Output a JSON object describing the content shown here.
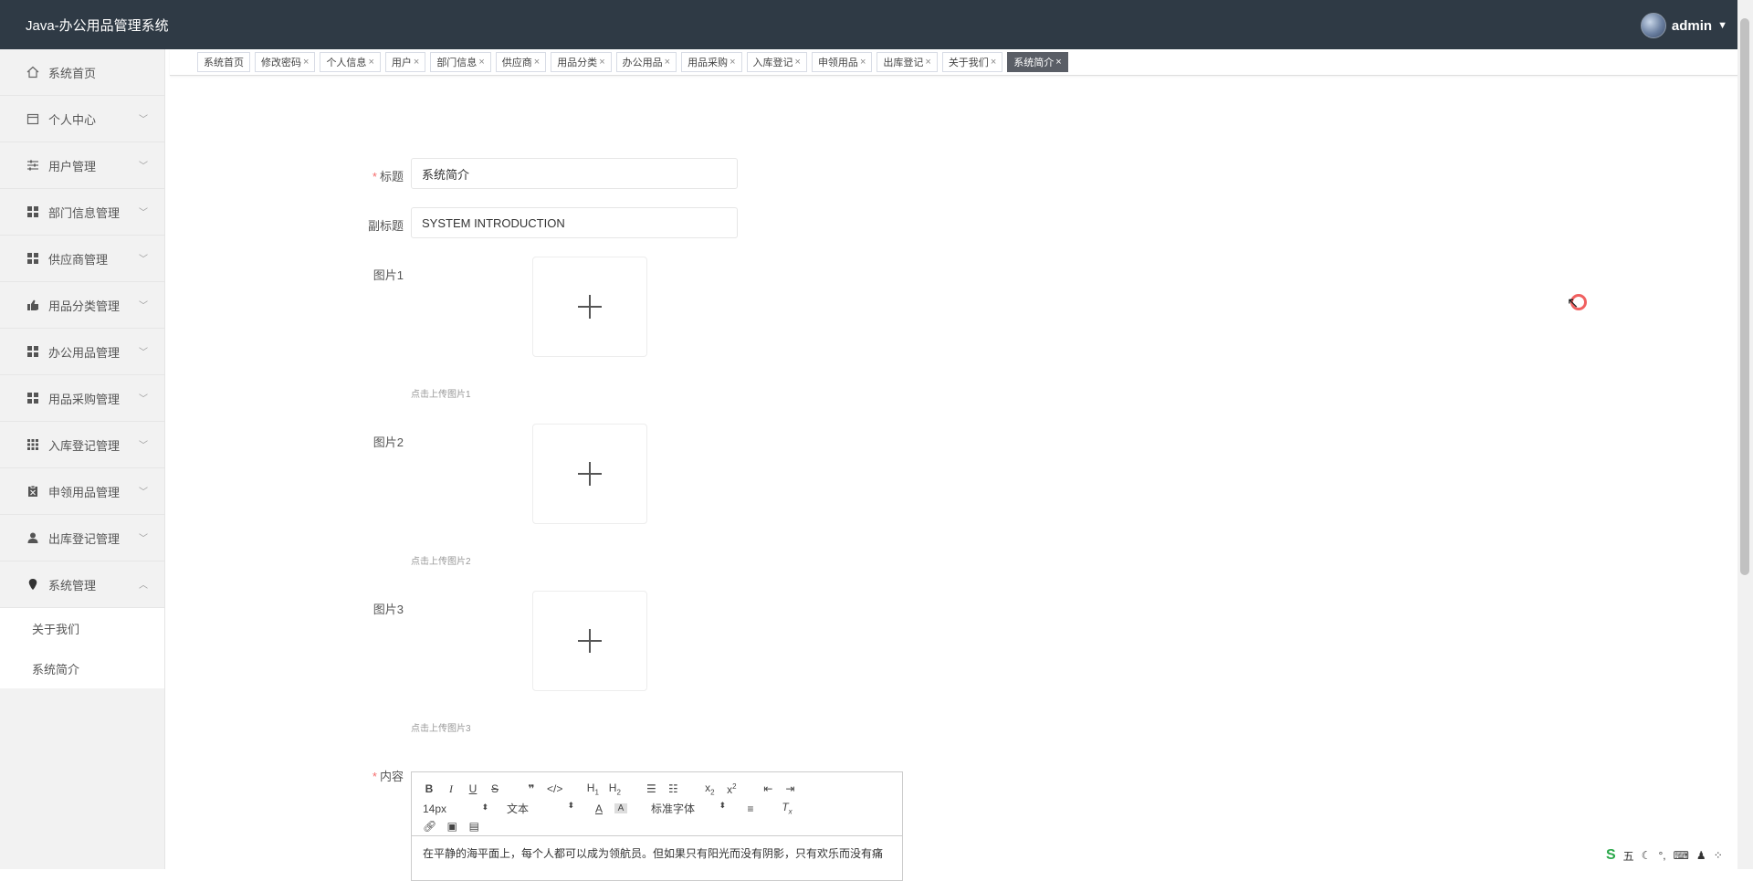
{
  "app": {
    "title": "Java-办公用品管理系统",
    "username": "admin"
  },
  "sidebar": {
    "items": [
      {
        "label": "系统首页",
        "icon": "home-icon"
      },
      {
        "label": "个人中心",
        "icon": "calendar-icon"
      },
      {
        "label": "用户管理",
        "icon": "sliders-icon"
      },
      {
        "label": "部门信息管理",
        "icon": "grid-icon"
      },
      {
        "label": "供应商管理",
        "icon": "grid-icon"
      },
      {
        "label": "用品分类管理",
        "icon": "thumb-icon"
      },
      {
        "label": "办公用品管理",
        "icon": "grid-icon"
      },
      {
        "label": "用品采购管理",
        "icon": "grid-icon"
      },
      {
        "label": "入库登记管理",
        "icon": "apps-icon"
      },
      {
        "label": "申领用品管理",
        "icon": "clipboard-icon"
      },
      {
        "label": "出库登记管理",
        "icon": "user-icon"
      },
      {
        "label": "系统管理",
        "icon": "bulb-icon"
      }
    ],
    "sub_items": [
      "关于我们",
      "系统简介"
    ]
  },
  "tabs": [
    {
      "label": "系统首页",
      "closable": false
    },
    {
      "label": "修改密码",
      "closable": true
    },
    {
      "label": "个人信息",
      "closable": true
    },
    {
      "label": "用户",
      "closable": true
    },
    {
      "label": "部门信息",
      "closable": true
    },
    {
      "label": "供应商",
      "closable": true
    },
    {
      "label": "用品分类",
      "closable": true
    },
    {
      "label": "办公用品",
      "closable": true
    },
    {
      "label": "用品采购",
      "closable": true
    },
    {
      "label": "入库登记",
      "closable": true
    },
    {
      "label": "申领用品",
      "closable": true
    },
    {
      "label": "出库登记",
      "closable": true
    },
    {
      "label": "关于我们",
      "closable": true
    },
    {
      "label": "系统简介",
      "closable": true,
      "active": true
    }
  ],
  "form": {
    "title_label": "标题",
    "title_value": "系统简介",
    "subtitle_label": "副标题",
    "subtitle_value": "SYSTEM INTRODUCTION",
    "image1_label": "图片1",
    "image1_tip": "点击上传图片1",
    "image2_label": "图片2",
    "image2_tip": "点击上传图片2",
    "image3_label": "图片3",
    "image3_tip": "点击上传图片3",
    "content_label": "内容"
  },
  "editor": {
    "size_select": "14px",
    "header_select": "文本",
    "font_select": "标准字体",
    "content": "在平静的海平面上，每个人都可以成为领航员。但如果只有阳光而没有阴影，只有欢乐而没有痛"
  },
  "ime": {
    "label": "五"
  },
  "colors": {
    "topbar": "#2f3a45",
    "active_tab": "#5a5e66",
    "required": "#f56c6c"
  }
}
